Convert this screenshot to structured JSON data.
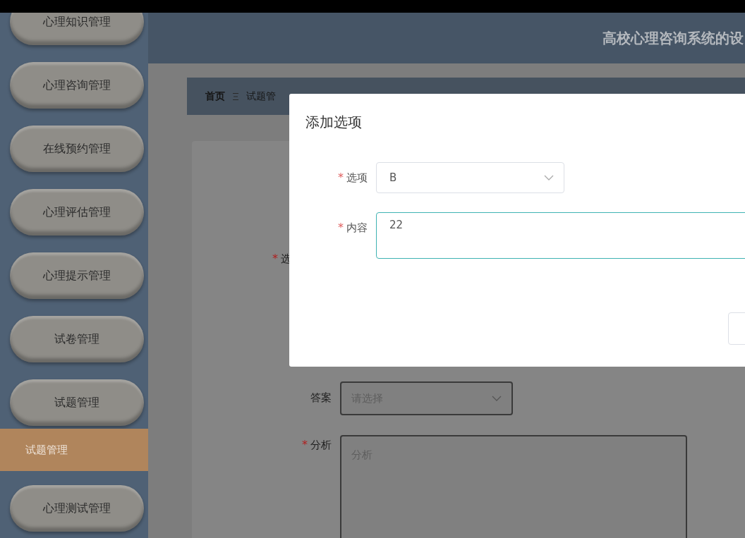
{
  "header": {
    "title": "高校心理咨询系统的设"
  },
  "sidebar": {
    "items": [
      {
        "label": "心理知识管理",
        "selected": false
      },
      {
        "label": "心理咨询管理",
        "selected": false
      },
      {
        "label": "在线预约管理",
        "selected": false
      },
      {
        "label": "心理评估管理",
        "selected": false
      },
      {
        "label": "心理提示管理",
        "selected": false
      },
      {
        "label": "试卷管理",
        "selected": false
      },
      {
        "label": "试题管理",
        "selected": false,
        "children": [
          {
            "label": "试题管理",
            "selected": true
          }
        ]
      },
      {
        "label": "心理测试管理",
        "selected": false
      }
    ]
  },
  "breadcrumb": {
    "items": [
      "首页",
      "试题管"
    ]
  },
  "form": {
    "fields": [
      {
        "kind": "label_only",
        "label": "选",
        "required_mark": "*"
      },
      {
        "kind": "select",
        "label": "答案",
        "placeholder": "请选择"
      },
      {
        "kind": "textarea",
        "label": "分析",
        "required_mark": "*",
        "placeholder": "分析"
      }
    ]
  },
  "dialog": {
    "title": "添加选项",
    "fields": [
      {
        "kind": "select",
        "label": "选项",
        "required_mark": "*",
        "value": "B"
      },
      {
        "kind": "textarea",
        "label": "内容",
        "required_mark": "*",
        "value": "22",
        "focused": true
      }
    ]
  }
}
